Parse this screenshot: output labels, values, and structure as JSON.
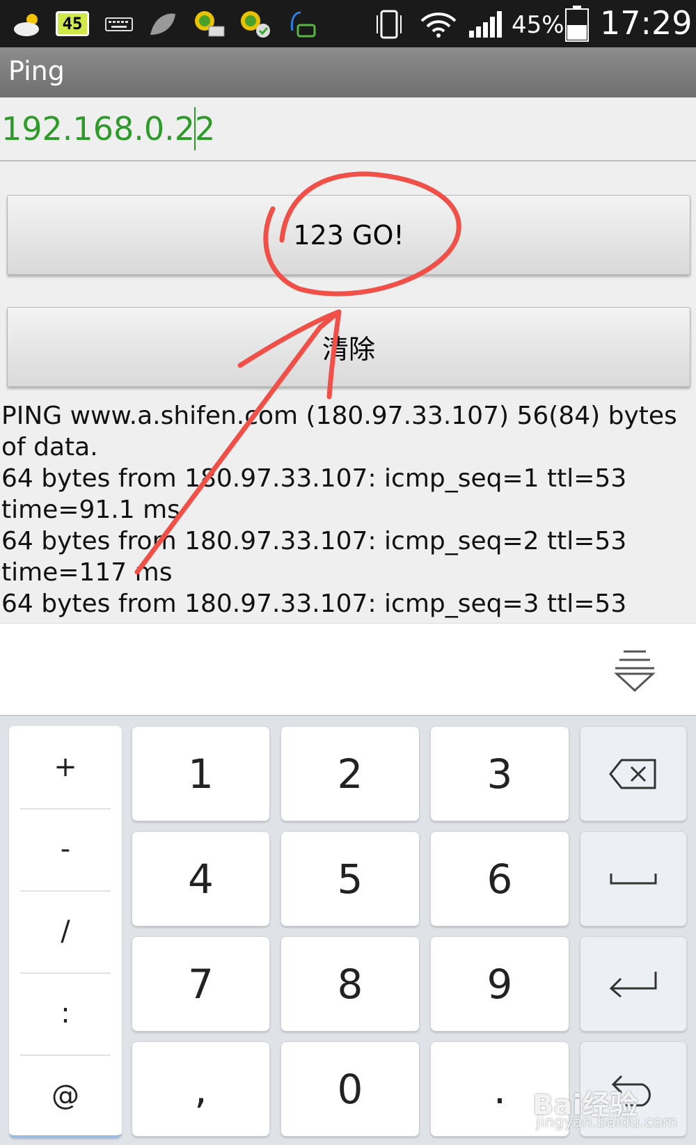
{
  "status_bar": {
    "badge": "45",
    "battery_percent": "45%",
    "time": "17:29",
    "icons": [
      "weather-icon",
      "battery-badge-icon",
      "keyboard-icon",
      "leaf-icon",
      "mail-download-icon",
      "app-check-icon",
      "chat-icon",
      "vibrate-icon",
      "wifi-icon",
      "signal-icon",
      "battery-icon"
    ]
  },
  "app": {
    "title": "Ping",
    "ip_value": "192.168.0.22",
    "go_button": "123 GO!",
    "clear_button": "清除",
    "output_lines": [
      "PING www.a.shifen.com (180.97.33.107) 56(84) bytes of data.",
      "64 bytes from 180.97.33.107: icmp_seq=1 ttl=53 time=91.1 ms",
      "64 bytes from 180.97.33.107: icmp_seq=2 ttl=53 time=117 ms",
      "64 bytes from 180.97.33.107: icmp_seq=3 ttl=53"
    ]
  },
  "keyboard": {
    "symbols": [
      "+",
      "-",
      "/",
      ":",
      "@"
    ],
    "keys": [
      "1",
      "2",
      "3",
      "4",
      "5",
      "6",
      "7",
      "8",
      "9",
      ",",
      "0",
      "."
    ]
  },
  "watermark": {
    "brand": "Bai经验",
    "url": "jingyan.baidu.com"
  },
  "colors": {
    "input_text": "#2e9a2a",
    "annotation": "#f05048"
  }
}
